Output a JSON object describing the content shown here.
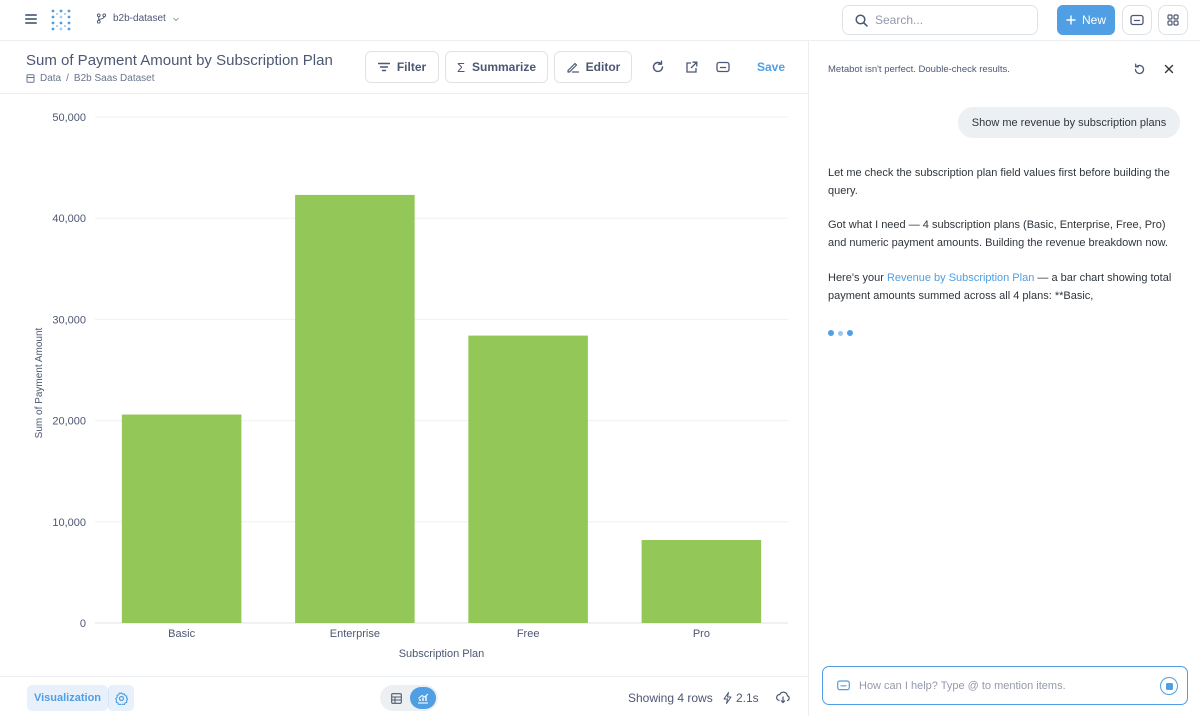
{
  "topbar": {
    "branch_label": "b2b-dataset",
    "search_placeholder": "Search...",
    "new_label": "New"
  },
  "question": {
    "title": "Sum of Payment Amount by Subscription Plan",
    "breadcrumb": [
      "Data",
      "/",
      "B2b Saas Dataset"
    ],
    "filter_label": "Filter",
    "summarize_label": "Summarize",
    "editor_label": "Editor",
    "save_label": "Save"
  },
  "chart_data": {
    "type": "bar",
    "categories": [
      "Basic",
      "Enterprise",
      "Free",
      "Pro"
    ],
    "values": [
      20600,
      42300,
      28400,
      8200
    ],
    "xlabel": "Subscription Plan",
    "ylabel": "Sum of Payment Amount",
    "ylim": [
      0,
      50000
    ],
    "yticks": [
      "0",
      "10,000",
      "20,000",
      "30,000",
      "40,000",
      "50,000"
    ],
    "bar_color": "#93c757",
    "grid": true
  },
  "footer": {
    "visualization_label": "Visualization",
    "rows_text": "Showing 4 rows",
    "timing_text": "2.1s"
  },
  "metabot": {
    "disclaimer": "Metabot isn't perfect. Double-check results.",
    "user_message": "Show me revenue by subscription plans",
    "messages": [
      "Let me check the subscription plan field values first before building the query.",
      "Got what I need — 4 subscription plans (Basic, Enterprise, Free, Pro) and numeric payment amounts. Building the revenue breakdown now."
    ],
    "final_prefix": "Here's your ",
    "final_link": "Revenue by Subscription Plan",
    "final_suffix": " — a bar chart showing total payment amounts summed across all 4 plans: **Basic,",
    "input_placeholder": "How can I help? Type @ to mention items."
  },
  "colors": {
    "accent": "#509ee3",
    "bar": "#93c757",
    "text": "#4c5773"
  }
}
